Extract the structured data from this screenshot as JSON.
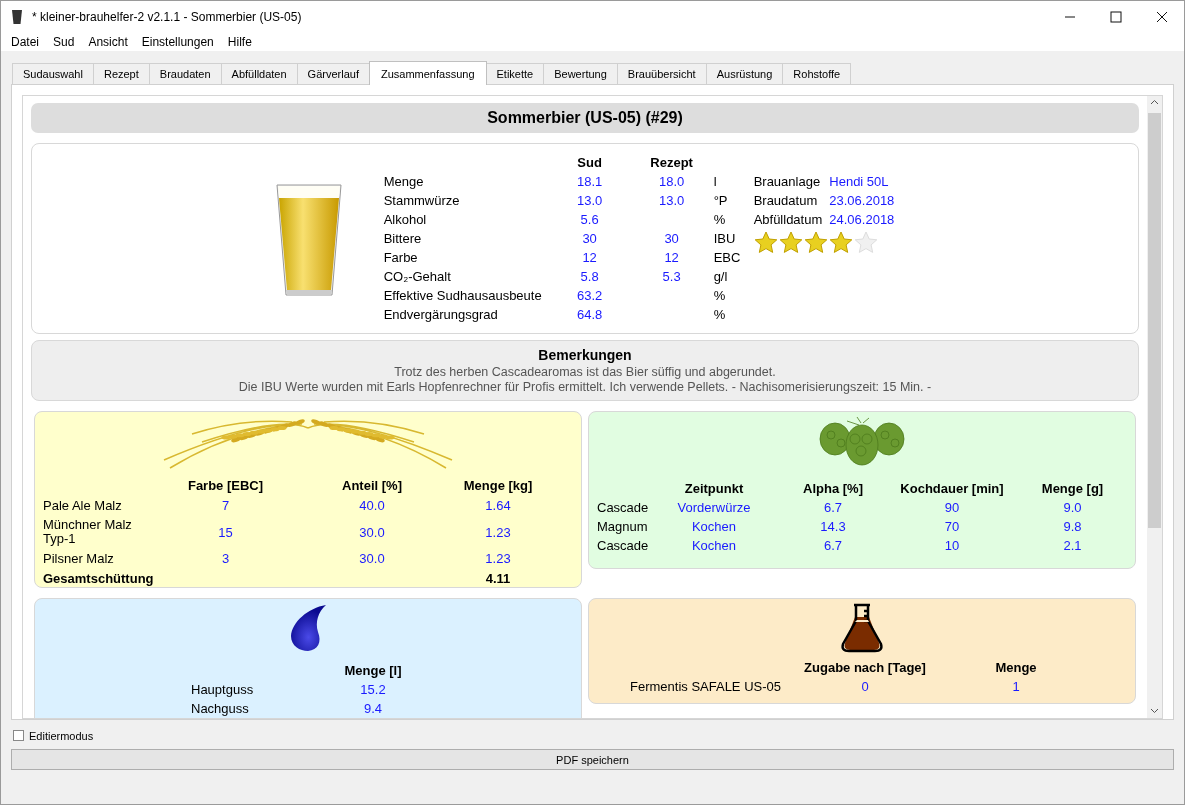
{
  "window": {
    "title": "* kleiner-brauhelfer-2 v2.1.1 - Sommerbier (US-05)"
  },
  "menu": [
    "Datei",
    "Sud",
    "Ansicht",
    "Einstellungen",
    "Hilfe"
  ],
  "tabs": [
    {
      "label": "Sudauswahl",
      "selected": false
    },
    {
      "label": "Rezept",
      "selected": false
    },
    {
      "label": "Braudaten",
      "selected": false
    },
    {
      "label": "Abfülldaten",
      "selected": false
    },
    {
      "label": "Gärverlauf",
      "selected": false
    },
    {
      "label": "Zusammenfassung",
      "selected": true
    },
    {
      "label": "Etikette",
      "selected": false
    },
    {
      "label": "Bewertung",
      "selected": false
    },
    {
      "label": "Brauübersicht",
      "selected": false
    },
    {
      "label": "Ausrüstung",
      "selected": false
    },
    {
      "label": "Rohstoffe",
      "selected": false
    }
  ],
  "summary": {
    "heading": "Sommerbier (US-05) (#29)",
    "columns": [
      "Sud",
      "Rezept"
    ],
    "rows": [
      {
        "label": "Menge",
        "sud": "18.1",
        "rezept": "18.0",
        "unit": "l"
      },
      {
        "label": "Stammwürze",
        "sud": "13.0",
        "rezept": "13.0",
        "unit": "°P"
      },
      {
        "label": "Alkohol",
        "sud": "5.6",
        "unit": "%"
      },
      {
        "label": "Bittere",
        "sud": "30",
        "rezept": "30",
        "unit": "IBU"
      },
      {
        "label": "Farbe",
        "sud": "12",
        "rezept": "12",
        "unit": "EBC"
      },
      {
        "label": "CO₂-Gehalt",
        "sud": "5.8",
        "rezept": "5.3",
        "unit": "g/l"
      },
      {
        "label": "Effektive Sudhausausbeute",
        "sud": "63.2",
        "unit": "%"
      },
      {
        "label": "Endvergärungsgrad",
        "sud": "64.8",
        "unit": "%"
      }
    ],
    "info": [
      {
        "label": "Brauanlage",
        "value": "Hendi 50L"
      },
      {
        "label": "Braudatum",
        "value": "23.06.2018"
      },
      {
        "label": "Abfülldatum",
        "value": "24.06.2018"
      }
    ],
    "stars": 4
  },
  "remarks": {
    "title": "Bemerkungen",
    "lines": [
      "Trotz des herben Cascadearomas ist das Bier süffig und abgerundet.",
      "Die IBU Werte wurden mit Earls Hopfenrechner für Profis ermittelt. Ich verwende Pellets. - Nachisomerisierungszeit: 15 Min. -"
    ]
  },
  "malt": {
    "columns": [
      "Farbe [EBC]",
      "Anteil [%]",
      "Menge [kg]"
    ],
    "rows": [
      {
        "name": "Pale Ale Malz",
        "values": [
          "7",
          "40.0",
          "1.64"
        ]
      },
      {
        "name": "Münchner Malz Typ-1",
        "values": [
          "15",
          "30.0",
          "1.23"
        ]
      },
      {
        "name": "Pilsner Malz",
        "values": [
          "3",
          "30.0",
          "1.23"
        ]
      }
    ],
    "total": {
      "label": "Gesamtschüttung",
      "value": "4.11"
    }
  },
  "hops": {
    "columns": [
      "Zeitpunkt",
      "Alpha [%]",
      "Kochdauer [min]",
      "Menge [g]"
    ],
    "rows": [
      {
        "name": "Cascade",
        "values": [
          "Vorderwürze",
          "6.7",
          "90",
          "9.0"
        ]
      },
      {
        "name": "Magnum",
        "values": [
          "Kochen",
          "14.3",
          "70",
          "9.8"
        ]
      },
      {
        "name": "Cascade",
        "values": [
          "Kochen",
          "6.7",
          "10",
          "2.1"
        ]
      }
    ]
  },
  "water": {
    "columns": [
      "Menge [l]"
    ],
    "rows": [
      {
        "name": "Hauptguss",
        "values": [
          "15.2"
        ]
      },
      {
        "name": "Nachguss",
        "values": [
          "9.4"
        ]
      }
    ]
  },
  "yeast": {
    "columns": [
      "Zugabe nach [Tage]",
      "Menge"
    ],
    "rows": [
      {
        "name": "Fermentis SAFALE US-05",
        "values": [
          "0",
          "1"
        ]
      }
    ]
  },
  "edit_mode": {
    "label": "Editiermodus",
    "checked": false
  },
  "pdf_button": "PDF speichern"
}
